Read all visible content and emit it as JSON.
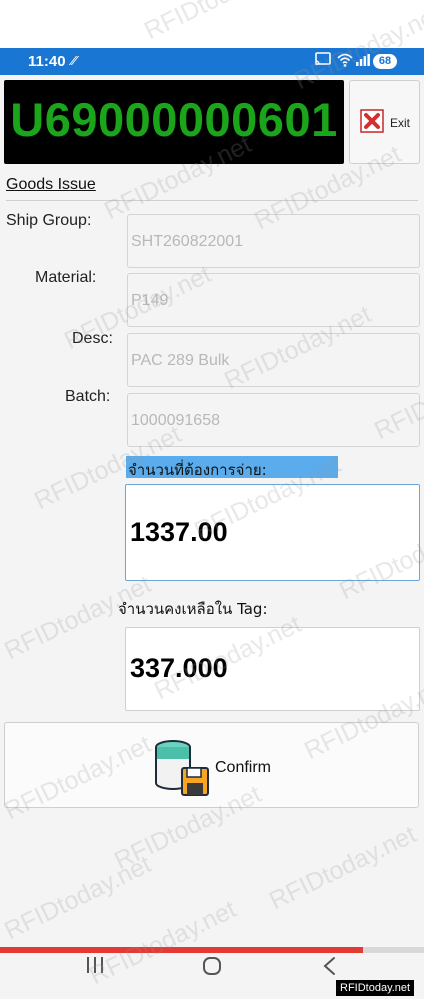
{
  "status_bar": {
    "time": "11:40",
    "left_indicator": "⁄⁄",
    "battery": "68",
    "color": "#1976d2"
  },
  "tag": {
    "value": "U69000000601",
    "text_color": "#1aa51a"
  },
  "exit_button": {
    "label": "Exit"
  },
  "screen": {
    "title": "Goods Issue"
  },
  "fields": {
    "ship_group": {
      "label": "Ship Group:",
      "value": "SHT260822001"
    },
    "material": {
      "label": "Material:",
      "value": "P149"
    },
    "desc": {
      "label": "Desc:",
      "value": "PAC 289 Bulk"
    },
    "batch": {
      "label": "Batch:",
      "value": "1000091658"
    }
  },
  "issue_quantity": {
    "label": "จำนวนที่ต้องการจ่าย:",
    "value": "1337.00",
    "highlight_color": "#5aacec"
  },
  "remaining_in_tag": {
    "label": "จำนวนคงเหลือใน Tag:",
    "value": "337.000"
  },
  "confirm_button": {
    "label": "Confirm"
  },
  "progress": {
    "fraction": 0.855,
    "color": "#e53935"
  },
  "watermark": {
    "text": "RFIDtoday.net",
    "corner_text": "RFIDtoday.net"
  },
  "icons": {
    "status": [
      "cast-icon",
      "wifi-icon",
      "signal-icon"
    ],
    "exit": "close-x-icon",
    "confirm": "database-save-icon",
    "nav": [
      "recent-apps-icon",
      "home-icon",
      "back-icon"
    ]
  }
}
